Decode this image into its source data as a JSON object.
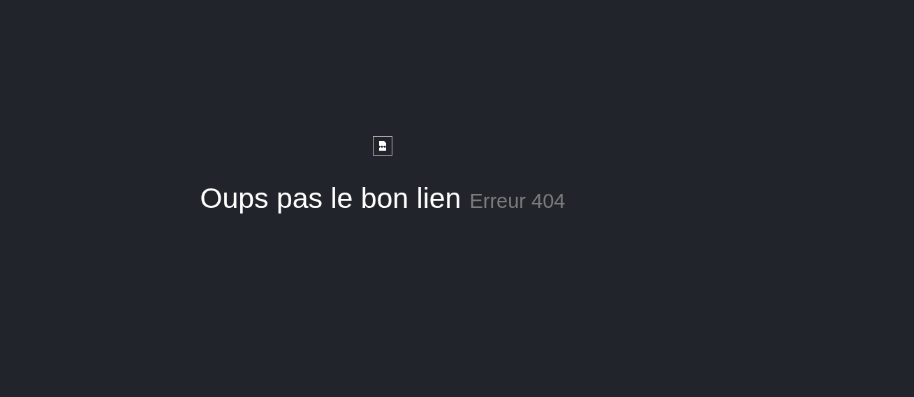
{
  "heading": {
    "title": "Oups pas le bon lien",
    "subtitle": "Erreur 404"
  }
}
